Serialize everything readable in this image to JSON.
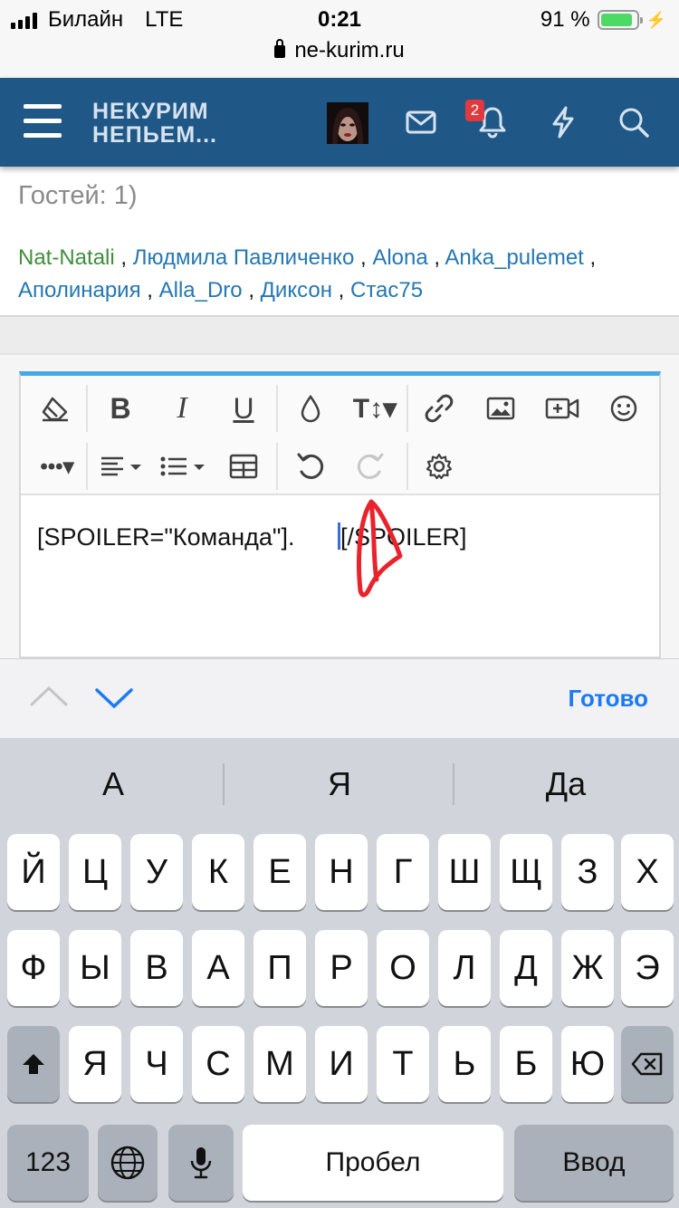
{
  "status_bar": {
    "carrier": "Билайн",
    "network": "LTE",
    "time": "0:21",
    "battery": "91 %",
    "battery_level": 0.91
  },
  "browser": {
    "url": "ne-kurim.ru"
  },
  "header": {
    "logo_line1": "НЕКУРИМ",
    "logo_line2": "НЕПЬЕМ...",
    "notification_count": "2",
    "brand_color": "#1f5786"
  },
  "online": {
    "guests_text": "Гостей: 1)",
    "users": [
      "Nat-Natali",
      "Людмила Павличенко",
      "Alona",
      "Anka_pulemet",
      "Аполинария",
      "Alla_Dro",
      "Диксон",
      "Стас75"
    ],
    "separator": " , "
  },
  "editor": {
    "text_before": "[SPOILER=\"Команда\"]. ",
    "text_after": "[/SPOILER]",
    "accent_color": "#47a7eb"
  },
  "accessory": {
    "done_label": "Готово"
  },
  "keyboard": {
    "suggestions": [
      "А",
      "Я",
      "Да"
    ],
    "row1": [
      "Й",
      "Ц",
      "У",
      "К",
      "Е",
      "Н",
      "Г",
      "Ш",
      "Щ",
      "З",
      "Х"
    ],
    "row2": [
      "Ф",
      "Ы",
      "В",
      "А",
      "П",
      "Р",
      "О",
      "Л",
      "Д",
      "Ж",
      "Э"
    ],
    "row3": [
      "Я",
      "Ч",
      "С",
      "М",
      "И",
      "Т",
      "Ь",
      "Б",
      "Ю"
    ],
    "numbers_label": "123",
    "space_label": "Пробел",
    "return_label": "Ввод"
  }
}
